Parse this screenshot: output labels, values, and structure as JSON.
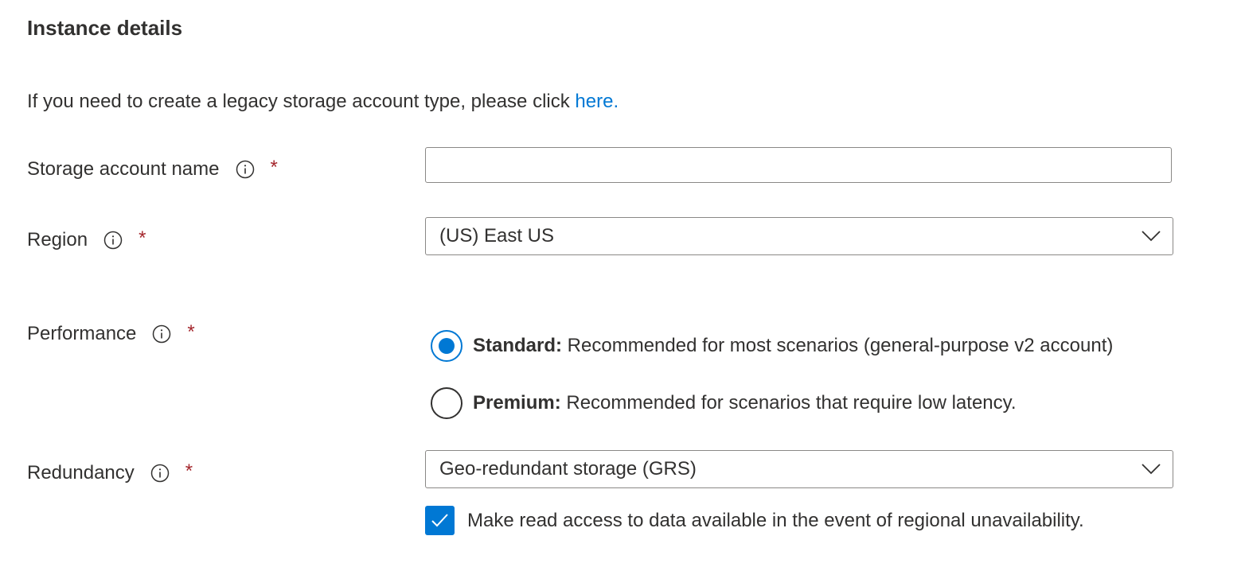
{
  "section": {
    "title": "Instance details"
  },
  "legacy": {
    "text": "If you need to create a legacy storage account type, please click ",
    "link_text": "here."
  },
  "fields": {
    "storage_account_name": {
      "label": "Storage account name",
      "required_marker": "*",
      "value": "",
      "placeholder": ""
    },
    "region": {
      "label": "Region",
      "required_marker": "*",
      "selected_value": "(US) East US"
    },
    "performance": {
      "label": "Performance",
      "required_marker": "*",
      "options": [
        {
          "title": "Standard:",
          "description": " Recommended for most scenarios (general-purpose v2 account)",
          "checked": true
        },
        {
          "title": "Premium:",
          "description": " Recommended for scenarios that require low latency.",
          "checked": false
        }
      ]
    },
    "redundancy": {
      "label": "Redundancy",
      "required_marker": "*",
      "selected_value": "Geo-redundant storage (GRS)",
      "read_access_checkbox": {
        "label": "Make read access to data available in the event of regional unavailability.",
        "checked": true
      }
    }
  },
  "colors": {
    "accent": "#0078d4",
    "required": "#a4262c",
    "text": "#323130",
    "border": "#8a8886"
  },
  "icons": {
    "info": "info-icon",
    "chevron": "chevron-down-icon",
    "check": "checkmark-icon"
  }
}
